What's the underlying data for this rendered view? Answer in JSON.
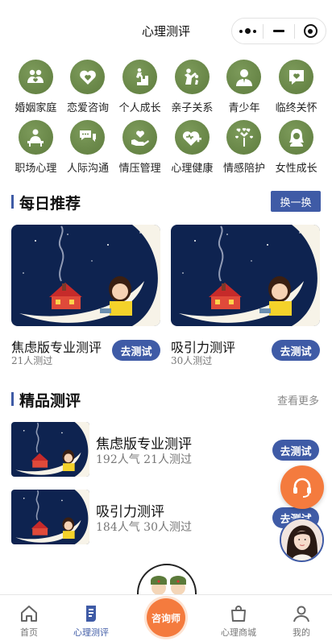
{
  "header": {
    "title": "心理测评"
  },
  "categories": [
    {
      "label": "婚姻家庭",
      "icon": "family-icon"
    },
    {
      "label": "恋爱咨询",
      "icon": "love-hearts-icon"
    },
    {
      "label": "个人成长",
      "icon": "climbing-stairs-icon"
    },
    {
      "label": "亲子关系",
      "icon": "parent-child-icon"
    },
    {
      "label": "青少年",
      "icon": "teen-icon"
    },
    {
      "label": "临终关怀",
      "icon": "heart-bubble-icon"
    },
    {
      "label": "职场心理",
      "icon": "office-worker-icon"
    },
    {
      "label": "人际沟通",
      "icon": "chat-bubbles-icon"
    },
    {
      "label": "情压管理",
      "icon": "hand-heart-icon"
    },
    {
      "label": "心理健康",
      "icon": "health-heart-icon"
    },
    {
      "label": "情感陪护",
      "icon": "heart-tree-icon"
    },
    {
      "label": "女性成长",
      "icon": "woman-icon"
    }
  ],
  "daily": {
    "title": "每日推荐",
    "swap_label": "换一换",
    "cards": [
      {
        "name": "焦虑版专业测评",
        "count": "21人测过",
        "button": "去测试"
      },
      {
        "name": "吸引力测评",
        "count": "30人测过",
        "button": "去测试"
      }
    ]
  },
  "featured": {
    "title": "精品测评",
    "more_label": "查看更多",
    "items": [
      {
        "name": "焦虑版专业测评",
        "meta": "192人气 21人测过",
        "button": "去测试"
      },
      {
        "name": "吸引力测评",
        "meta": "184人气 30人测过",
        "button": "去测试"
      }
    ]
  },
  "tabbar": {
    "home": "首页",
    "assess": "心理测评",
    "consult": "咨询师",
    "mall": "心理商城",
    "mine": "我的"
  },
  "colors": {
    "accent": "#3f5ba6",
    "orange": "#f47b3e",
    "icon_green": "#6b8a4a"
  }
}
